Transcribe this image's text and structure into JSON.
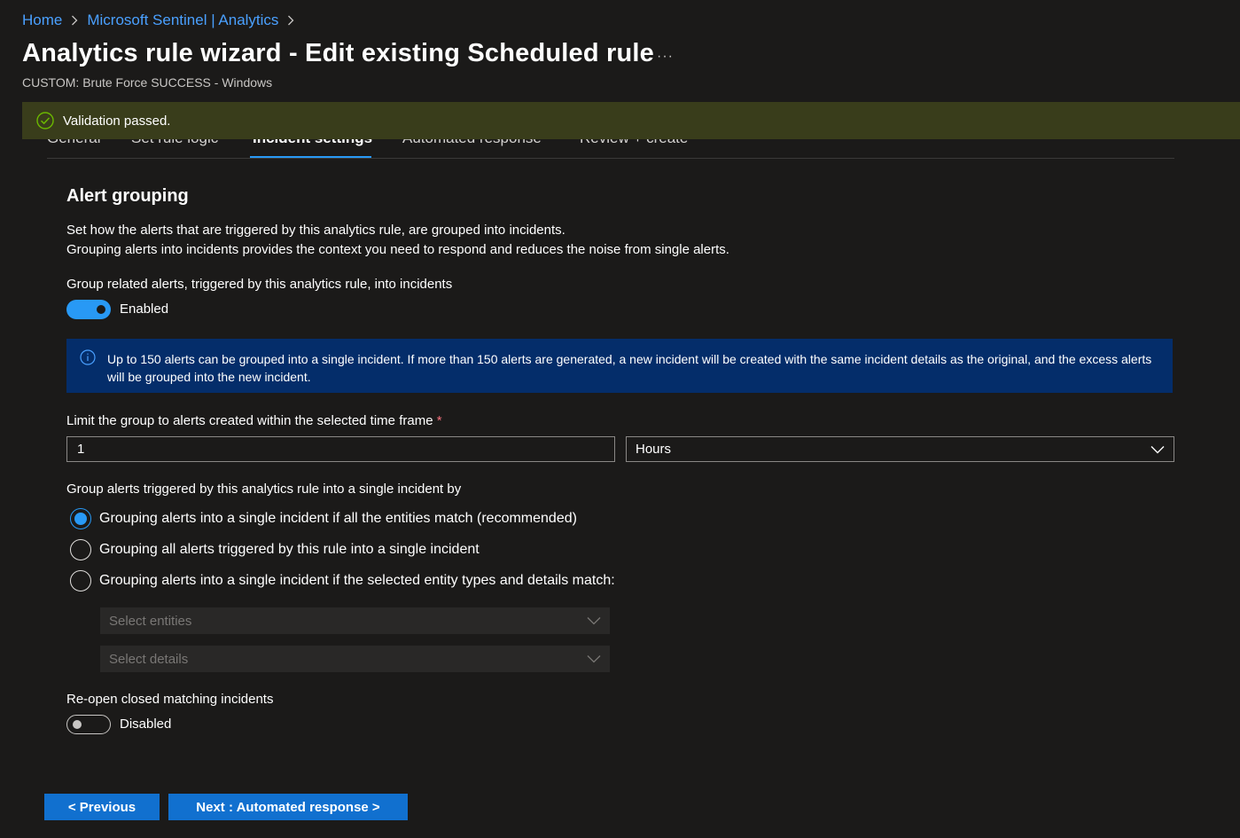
{
  "breadcrumb": {
    "items": [
      "Home",
      "Microsoft Sentinel | Analytics"
    ]
  },
  "header": {
    "title": "Analytics rule wizard - Edit existing Scheduled rule",
    "more": "···",
    "subtitle": "CUSTOM: Brute Force SUCCESS - Windows"
  },
  "tabs": [
    {
      "label": "General"
    },
    {
      "label": "Set rule logic"
    },
    {
      "label": "Incident settings",
      "active": true
    },
    {
      "label": "Automated response"
    },
    {
      "label": "Review + create"
    }
  ],
  "banner": {
    "text": "Validation passed.",
    "color": "#393d1b"
  },
  "alert_grouping": {
    "title": "Alert grouping",
    "desc_line1": "Set how the alerts that are triggered by this analytics rule, are grouped into incidents.",
    "desc_line2": "Grouping alerts into incidents provides the context you need to respond and reduces the noise from single alerts.",
    "group_label": "Group related alerts, triggered by this analytics rule, into incidents",
    "group_toggle_label": "Enabled",
    "info_text": "Up to 150 alerts can be grouped into a single incident. If more than 150 alerts are generated, a new incident will be created with the same incident details as the original, and the excess alerts will be grouped into the new incident.",
    "limit_label": "Limit the group to alerts created within the selected time frame",
    "required_mark": "*",
    "limit_value": "1",
    "limit_unit": "Hours",
    "by_label": "Group alerts triggered by this analytics rule into a single incident by",
    "options": [
      {
        "label": "Grouping alerts into a single incident if all the entities match (recommended)",
        "checked": true
      },
      {
        "label": "Grouping all alerts triggered by this rule into a single incident",
        "checked": false
      },
      {
        "label": "Grouping alerts into a single incident if the selected entity types and details match:",
        "checked": false
      }
    ],
    "select_entities_placeholder": "Select entities",
    "select_details_placeholder": "Select details",
    "reopen_label": "Re-open closed matching incidents",
    "reopen_toggle_label": "Disabled"
  },
  "footer": {
    "previous_label": "< Previous",
    "next_label": "Next : Automated response >"
  },
  "colors": {
    "accent": "#2899f5",
    "link": "#4aa0ff",
    "info_bg": "#042d6a",
    "button": "#1170cf"
  }
}
